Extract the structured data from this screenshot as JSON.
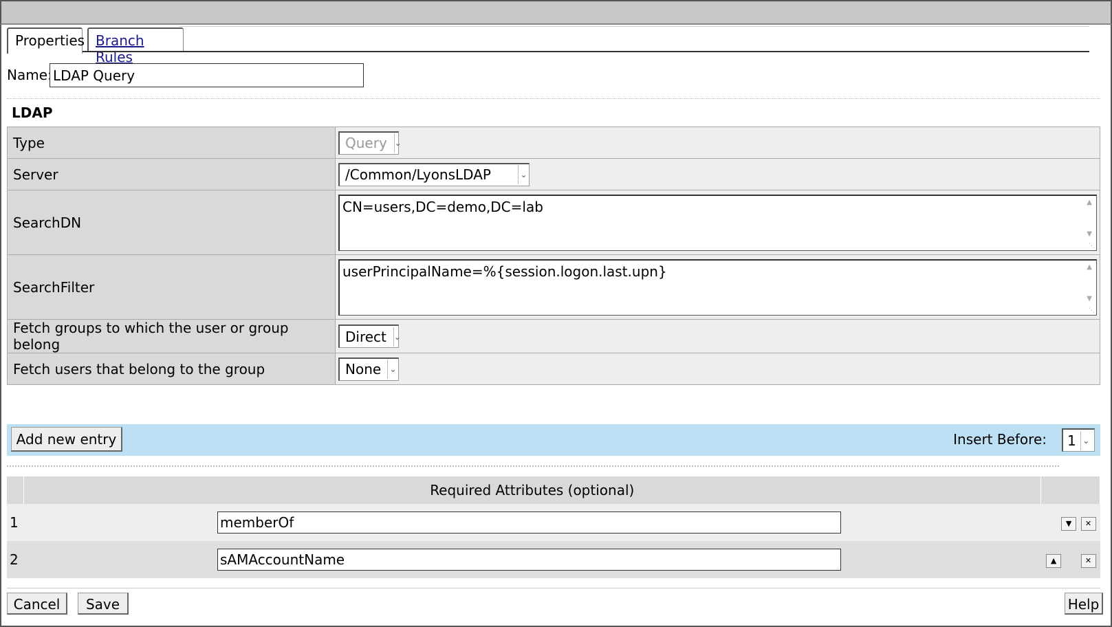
{
  "tabs": {
    "properties": "Properties",
    "branch_rules": "Branch Rules"
  },
  "name": {
    "label": "Name:",
    "value": "LDAP Query"
  },
  "section_title": "LDAP",
  "props": {
    "type": {
      "label": "Type",
      "value": "Query"
    },
    "server": {
      "label": "Server",
      "value": "/Common/LyonsLDAP"
    },
    "searchdn": {
      "label": "SearchDN",
      "value": "CN=users,DC=demo,DC=lab"
    },
    "searchfilter": {
      "label": "SearchFilter",
      "value": "userPrincipalName=%{session.logon.last.upn}"
    },
    "fetch_groups": {
      "label": "Fetch groups to which the user or group belong",
      "value": "Direct"
    },
    "fetch_users": {
      "label": "Fetch users that belong to the group",
      "value": "None"
    }
  },
  "toolbar": {
    "add_entry": "Add new entry",
    "insert_before_label": "Insert Before:",
    "insert_before_value": "1"
  },
  "attrs": {
    "header": "Required Attributes (optional)",
    "rows": [
      {
        "num": "1",
        "value": "memberOf"
      },
      {
        "num": "2",
        "value": "sAMAccountName"
      }
    ]
  },
  "footer": {
    "cancel": "Cancel",
    "save": "Save",
    "help": "Help"
  },
  "colors": {
    "toolbar_bg": "#bde0f5",
    "label_bg": "#d9d9d9",
    "value_bg": "#eeeeee"
  }
}
